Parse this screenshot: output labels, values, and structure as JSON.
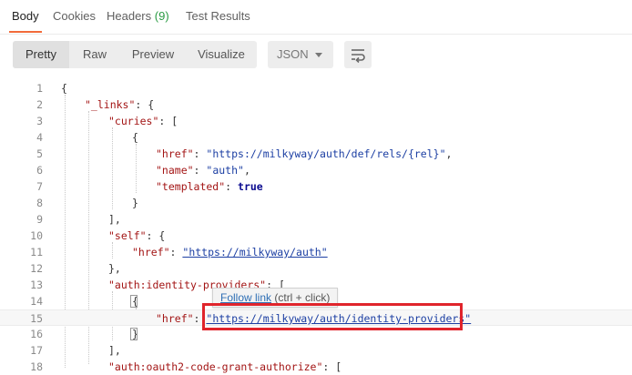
{
  "tabs": {
    "body": "Body",
    "cookies": "Cookies",
    "headers": "Headers",
    "headers_count": "(9)",
    "test_results": "Test Results"
  },
  "toolbar": {
    "pretty": "Pretty",
    "raw": "Raw",
    "preview": "Preview",
    "visualize": "Visualize",
    "format": "JSON"
  },
  "tooltip": {
    "link": "Follow link",
    "hint": "(ctrl + click)"
  },
  "lines": [
    {
      "n": "1",
      "segments": [
        {
          "t": "p",
          "v": "{"
        }
      ]
    },
    {
      "n": "2",
      "segments": [
        {
          "t": "k",
          "v": "\"_links\""
        },
        {
          "t": "p",
          "v": ": {"
        }
      ]
    },
    {
      "n": "3",
      "segments": [
        {
          "t": "k",
          "v": "\"curies\""
        },
        {
          "t": "p",
          "v": ": ["
        }
      ]
    },
    {
      "n": "4",
      "segments": [
        {
          "t": "p",
          "v": "{"
        }
      ]
    },
    {
      "n": "5",
      "segments": [
        {
          "t": "k",
          "v": "\"href\""
        },
        {
          "t": "p",
          "v": ": "
        },
        {
          "t": "s",
          "v": "\"https://milkyway/auth/def/rels/{rel}\""
        },
        {
          "t": "p",
          "v": ","
        }
      ]
    },
    {
      "n": "6",
      "segments": [
        {
          "t": "k",
          "v": "\"name\""
        },
        {
          "t": "p",
          "v": ": "
        },
        {
          "t": "s",
          "v": "\"auth\""
        },
        {
          "t": "p",
          "v": ","
        }
      ]
    },
    {
      "n": "7",
      "segments": [
        {
          "t": "k",
          "v": "\"templated\""
        },
        {
          "t": "p",
          "v": ": "
        },
        {
          "t": "bool",
          "v": "true"
        }
      ]
    },
    {
      "n": "8",
      "segments": [
        {
          "t": "p",
          "v": "}"
        }
      ]
    },
    {
      "n": "9",
      "segments": [
        {
          "t": "p",
          "v": "],"
        }
      ]
    },
    {
      "n": "10",
      "segments": [
        {
          "t": "k",
          "v": "\"self\""
        },
        {
          "t": "p",
          "v": ": {"
        }
      ]
    },
    {
      "n": "11",
      "segments": [
        {
          "t": "k",
          "v": "\"href\""
        },
        {
          "t": "p",
          "v": ": "
        },
        {
          "t": "link",
          "v": "\"https://milkyway/auth\""
        }
      ]
    },
    {
      "n": "12",
      "segments": [
        {
          "t": "p",
          "v": "},"
        }
      ]
    },
    {
      "n": "13",
      "segments": [
        {
          "t": "k",
          "v": "\"auth:identity-providers\""
        },
        {
          "t": "p",
          "v": ": ["
        }
      ]
    },
    {
      "n": "14",
      "segments": [
        {
          "t": "p",
          "v": "{"
        }
      ]
    },
    {
      "n": "15",
      "segments": [
        {
          "t": "k",
          "v": "\"href\""
        },
        {
          "t": "p",
          "v": ": "
        },
        {
          "t": "link",
          "v": "\"https://milkyway/auth/identity-providers\""
        }
      ]
    },
    {
      "n": "16",
      "segments": [
        {
          "t": "p",
          "v": "}"
        }
      ]
    },
    {
      "n": "17",
      "segments": [
        {
          "t": "p",
          "v": "],"
        }
      ]
    },
    {
      "n": "18",
      "segments": [
        {
          "t": "k",
          "v": "\"auth:oauth2-code-grant-authorize\""
        },
        {
          "t": "p",
          "v": ": ["
        }
      ]
    }
  ]
}
